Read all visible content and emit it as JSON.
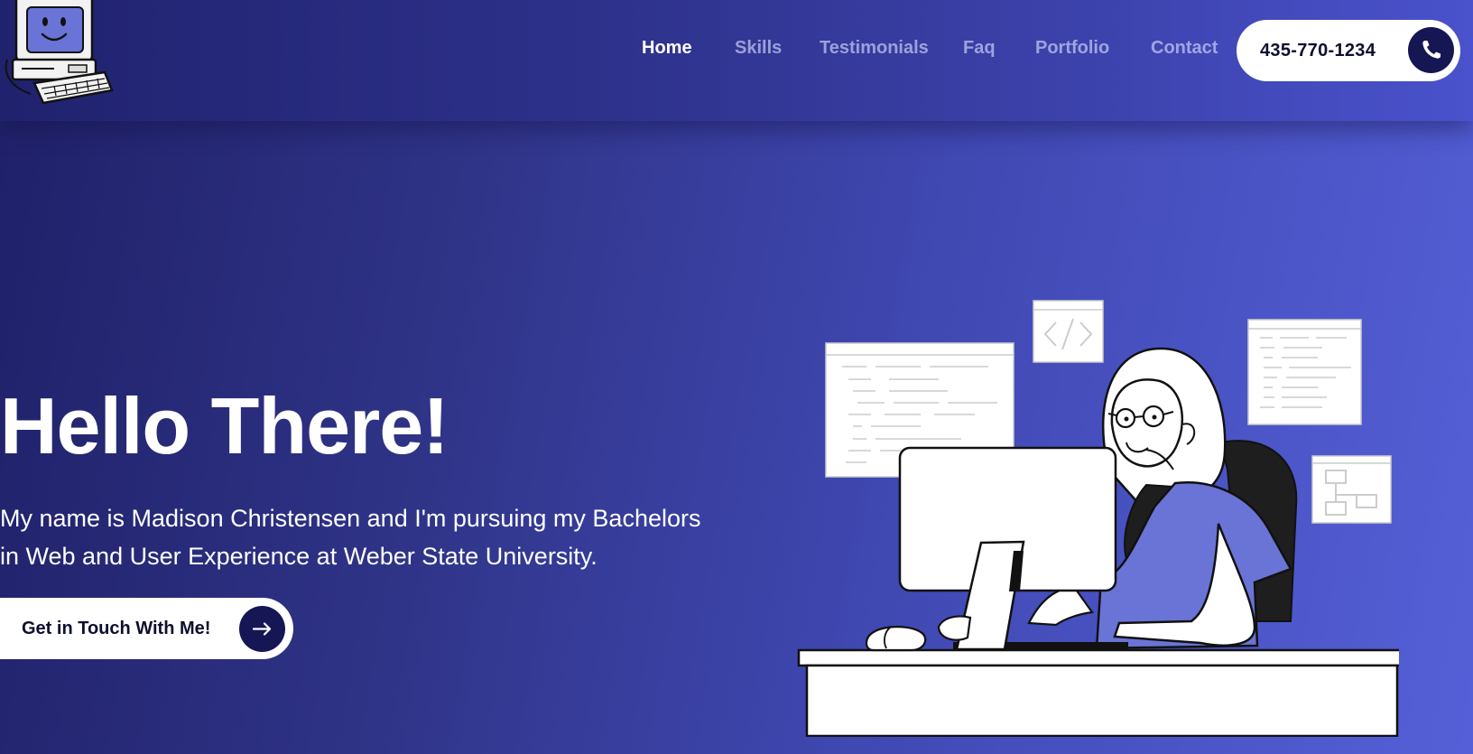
{
  "header": {
    "logo_icon": "retro-computer-icon",
    "nav": [
      {
        "label": "Home",
        "active": true
      },
      {
        "label": "Skills",
        "active": false
      },
      {
        "label": "Testimonials",
        "active": false
      },
      {
        "label": "Faq",
        "active": false
      },
      {
        "label": "Portfolio",
        "active": false
      },
      {
        "label": "Contact",
        "active": false
      }
    ],
    "phone": {
      "number": "435-770-1234",
      "icon": "phone-icon"
    }
  },
  "hero": {
    "title": "Hello There!",
    "text": "My name is Madison Christensen and I'm pursuing my Bachelors in Web and User Experience at Weber State University.",
    "cta_label": "Get in Touch With Me!",
    "cta_icon": "arrow-right-icon",
    "illustration": "woman-coding-at-desk-illustration"
  },
  "colors": {
    "background_start": "#1f2068",
    "background_end": "#5560d8",
    "accent_dark": "#171654",
    "shirt": "#6a74d6"
  }
}
